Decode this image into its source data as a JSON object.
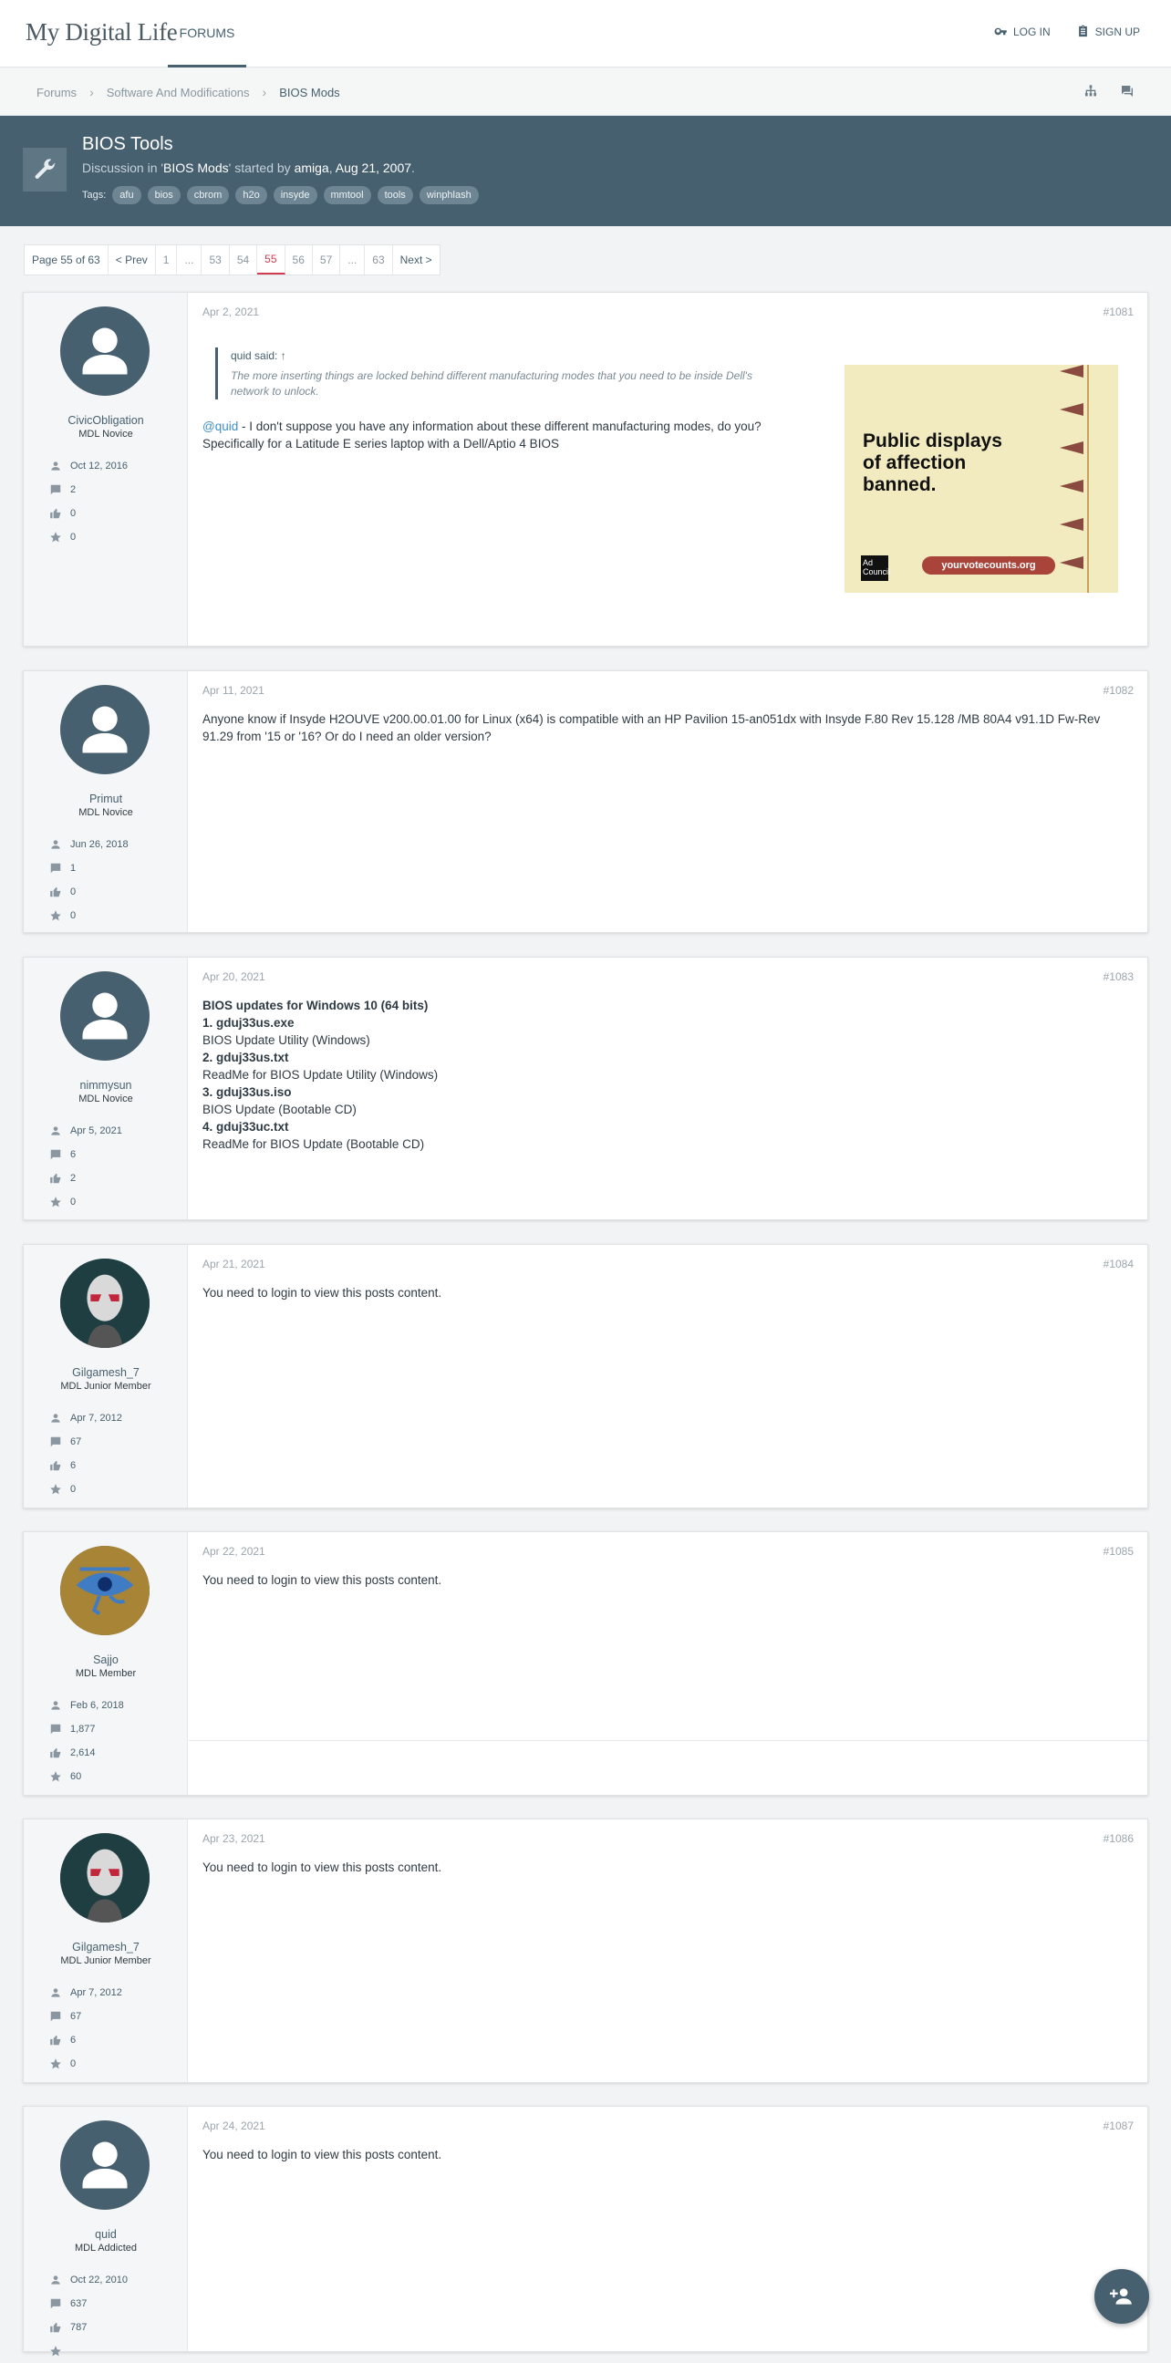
{
  "header": {
    "logo": "My Digital Life",
    "nav_forums": "FORUMS",
    "login": "LOG IN",
    "signup": "SIGN UP"
  },
  "breadcrumbs": [
    "Forums",
    "Software And Modifications",
    "BIOS Mods"
  ],
  "thread": {
    "title": "BIOS Tools",
    "meta_prefix": "Discussion in '",
    "forum": "BIOS Mods",
    "meta_mid": "' started by ",
    "author": "amiga",
    "meta_sep": ", ",
    "date": "Aug 21, 2007",
    "meta_end": ".",
    "tags_label": "Tags:",
    "tags": [
      "afu",
      "bios",
      "cbrom",
      "h2o",
      "insyde",
      "mmtool",
      "tools",
      "winphlash"
    ]
  },
  "pagination": {
    "label": "Page 55 of 63",
    "prev": "< Prev",
    "pages": [
      "1",
      "...",
      "53",
      "54",
      "55",
      "56",
      "57",
      "...",
      "63"
    ],
    "current": "55",
    "next": "Next >"
  },
  "login_message": "You need to login to view this posts content.",
  "posts": [
    {
      "username": "CivicObligation",
      "title": "MDL Novice",
      "joined": "Oct 12, 2016",
      "messages": "2",
      "likes": "0",
      "points": "0",
      "date": "Apr 2, 2021",
      "number": "#1081",
      "quote_head": "quid said: ↑",
      "quote_text": "The more inserting things are locked behind different manufacturing modes that you need to be inside Dell's network to unlock.",
      "mention": "@quid",
      "text": " - I don't suppose you have any information about these different manufacturing modes, do you? Specifically for a Latitude E series laptop with a Dell/Aptio 4 BIOS"
    },
    {
      "username": "Primut",
      "title": "MDL Novice",
      "joined": "Jun 26, 2018",
      "messages": "1",
      "likes": "0",
      "points": "0",
      "date": "Apr 11, 2021",
      "number": "#1082",
      "text": "Anyone know if Insyde H2OUVE v200.00.01.00 for Linux (x64) is compatible with an HP Pavilion 15-an051dx with Insyde F.80 Rev 15.128 /MB 80A4 v91.1D Fw-Rev 91.29 from '15 or '16? Or do I need an older version?"
    },
    {
      "username": "nimmysun",
      "title": "MDL Novice",
      "joined": "Apr 5, 2021",
      "messages": "6",
      "likes": "2",
      "points": "0",
      "date": "Apr 20, 2021",
      "number": "#1083",
      "lines": [
        "BIOS updates for Windows 10 (64 bits)",
        "1. gduj33us.exe",
        "BIOS Update Utility (Windows)",
        "2. gduj33us.txt",
        "ReadMe for BIOS Update Utility (Windows)",
        "3. gduj33us.iso",
        "BIOS Update (Bootable CD)",
        "4. gduj33uc.txt",
        "ReadMe for BIOS Update (Bootable CD)"
      ]
    },
    {
      "username": "Gilgamesh_7",
      "title": "MDL Junior Member",
      "joined": "Apr 7, 2012",
      "messages": "67",
      "likes": "6",
      "points": "0",
      "date": "Apr 21, 2021",
      "number": "#1084"
    },
    {
      "username": "Sajjo",
      "title": "MDL Member",
      "joined": "Feb 6, 2018",
      "messages": "1,877",
      "likes": "2,614",
      "points": "60",
      "date": "Apr 22, 2021",
      "number": "#1085"
    },
    {
      "username": "Gilgamesh_7",
      "title": "MDL Junior Member",
      "joined": "Apr 7, 2012",
      "messages": "67",
      "likes": "6",
      "points": "0",
      "date": "Apr 23, 2021",
      "number": "#1086"
    },
    {
      "username": "quid",
      "title": "MDL Addicted",
      "joined": "Oct 22, 2010",
      "messages": "637",
      "likes": "787",
      "points": "",
      "date": "Apr 24, 2021",
      "number": "#1087"
    }
  ],
  "ad": {
    "headline_1": "Public displays",
    "headline_2": "of affection",
    "headline_3": "banned.",
    "cta": "yourvotecounts.org",
    "logo": "Ad Council",
    "colors": {
      "background": "#f1ebbf",
      "pill": "#a8443a"
    }
  },
  "colors": {
    "primary": "#47606f",
    "link": "#3f8fca",
    "active_page": "#d33b4e"
  }
}
